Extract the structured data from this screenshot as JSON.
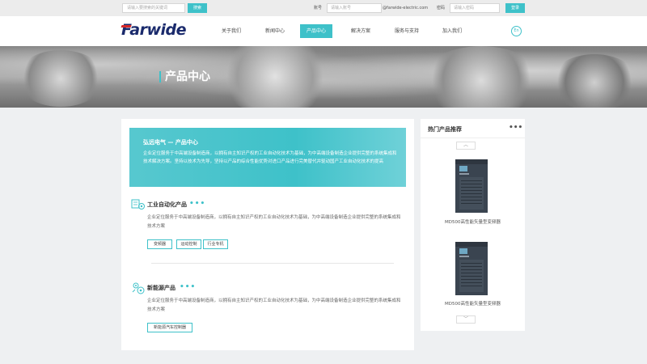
{
  "topbar": {
    "search_placeholder": "请输入要搜索的关键词",
    "search_button": "搜索",
    "account_label": "账号",
    "account_placeholder": "请输入账号",
    "email_domain": "@farwide-electric.com",
    "password_label": "密码",
    "password_placeholder": "请输入密码",
    "login_button": "登录"
  },
  "header": {
    "logo_text": "Farwide",
    "nav": [
      {
        "label": "关于我们",
        "active": false
      },
      {
        "label": "新闻中心",
        "active": false
      },
      {
        "label": "产品中心",
        "active": true
      },
      {
        "label": "解决方案",
        "active": false
      },
      {
        "label": "服务与支持",
        "active": false
      },
      {
        "label": "加入我们",
        "active": false
      }
    ],
    "lang_label": "En"
  },
  "banner": {
    "title": "产品中心"
  },
  "intro": {
    "title": "弘远电气 — 产品中心",
    "text": "企业定位服务于中高端设备制造商，以拥有自主知识产权的工业自动化技术为基础，为中高端设备制造企业提供完整的系统集成和技术解决方案。坚持以技术为先导，坚持以产品的综合性能优势对进口产品进行完美替代并驱动国产工业自动化技术的提高"
  },
  "sections": [
    {
      "title": "工业自动化产品",
      "dots": "•••",
      "text": "企业定位服务于中高端设备制造商，以拥有自主知识产权的工业自动化技术为基础，为中高端设备制造企业提供完整的系统集成和技术方案",
      "tags": [
        "变频器",
        "运动控制",
        "行业专机"
      ]
    },
    {
      "title": "新能源产品",
      "dots": "•••",
      "text": "企业定位服务于中高端设备制造商，以拥有自主知识产权的工业自动化技术为基础，为中高端设备制造企业提供完整的系统集成和技术方案",
      "tags": [
        "新能源汽车控制器"
      ]
    }
  ],
  "side": {
    "title": "热门产品推荐",
    "dots": "•••",
    "up_arrow": "︿",
    "down_arrow": "﹀",
    "products": [
      {
        "name": "MD500高性能矢量型变频器"
      },
      {
        "name": "MD500高性能矢量型变频器"
      }
    ]
  },
  "colors": {
    "accent": "#3ec1c9",
    "brand": "#1a2a6c",
    "logo_red": "#d62828"
  }
}
